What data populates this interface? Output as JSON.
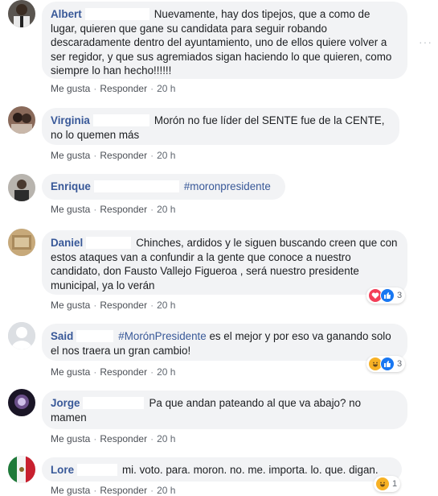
{
  "actions": {
    "like": "Me gusta",
    "reply": "Responder",
    "separator": "·"
  },
  "colors": {
    "name_link": "#385898",
    "bubble_bg": "#f2f3f5",
    "meta_text": "#606770"
  },
  "comments": [
    {
      "name": "Albert",
      "text": "Nuevamente, hay dos tipejos, que a como de lugar, quieren que gane su candidata para seguir robando descaradamente dentro del ayuntamiento, uno de ellos quiere volver a ser regidor, y que sus agremiados sigan haciendo lo que quieren, como siempre lo han hecho!!!!!!",
      "time": "20 h"
    },
    {
      "name": "Virginia",
      "text": "Morón no fue líder del SENTE fue de la CENTE, no lo quemen más",
      "time": "20 h"
    },
    {
      "name": "Enrique",
      "hashtag": "#moronpresidente",
      "time": "20 h"
    },
    {
      "name": "Daniel",
      "text": "Chinches, ardidos y le siguen buscando creen que con estos ataques van a confundir a la gente que conoce a nuestro candidato, don Fausto Vallejo Figueroa , será nuestro presidente municipal, ya lo verán",
      "time": "20 h",
      "reactions": {
        "icons": [
          "love-icon",
          "like-icon"
        ],
        "count": "3"
      }
    },
    {
      "name": "Said",
      "hashtag": "#MorónPresidente",
      "text": "es el mejor y por eso va ganando solo el nos traera un gran cambio!",
      "time": "20 h",
      "reactions": {
        "icons": [
          "haha-icon",
          "like-icon"
        ],
        "count": "3"
      }
    },
    {
      "name": "Jorge",
      "text": "Pa que andan pateando al que va abajo? no mamen",
      "time": "20 h"
    },
    {
      "name": "Lore",
      "text": "mi. voto. para. moron. no. me. importa. lo. que. digan.",
      "time": "20 h",
      "reactions": {
        "icons": [
          "haha-icon"
        ],
        "count": "1"
      }
    }
  ]
}
